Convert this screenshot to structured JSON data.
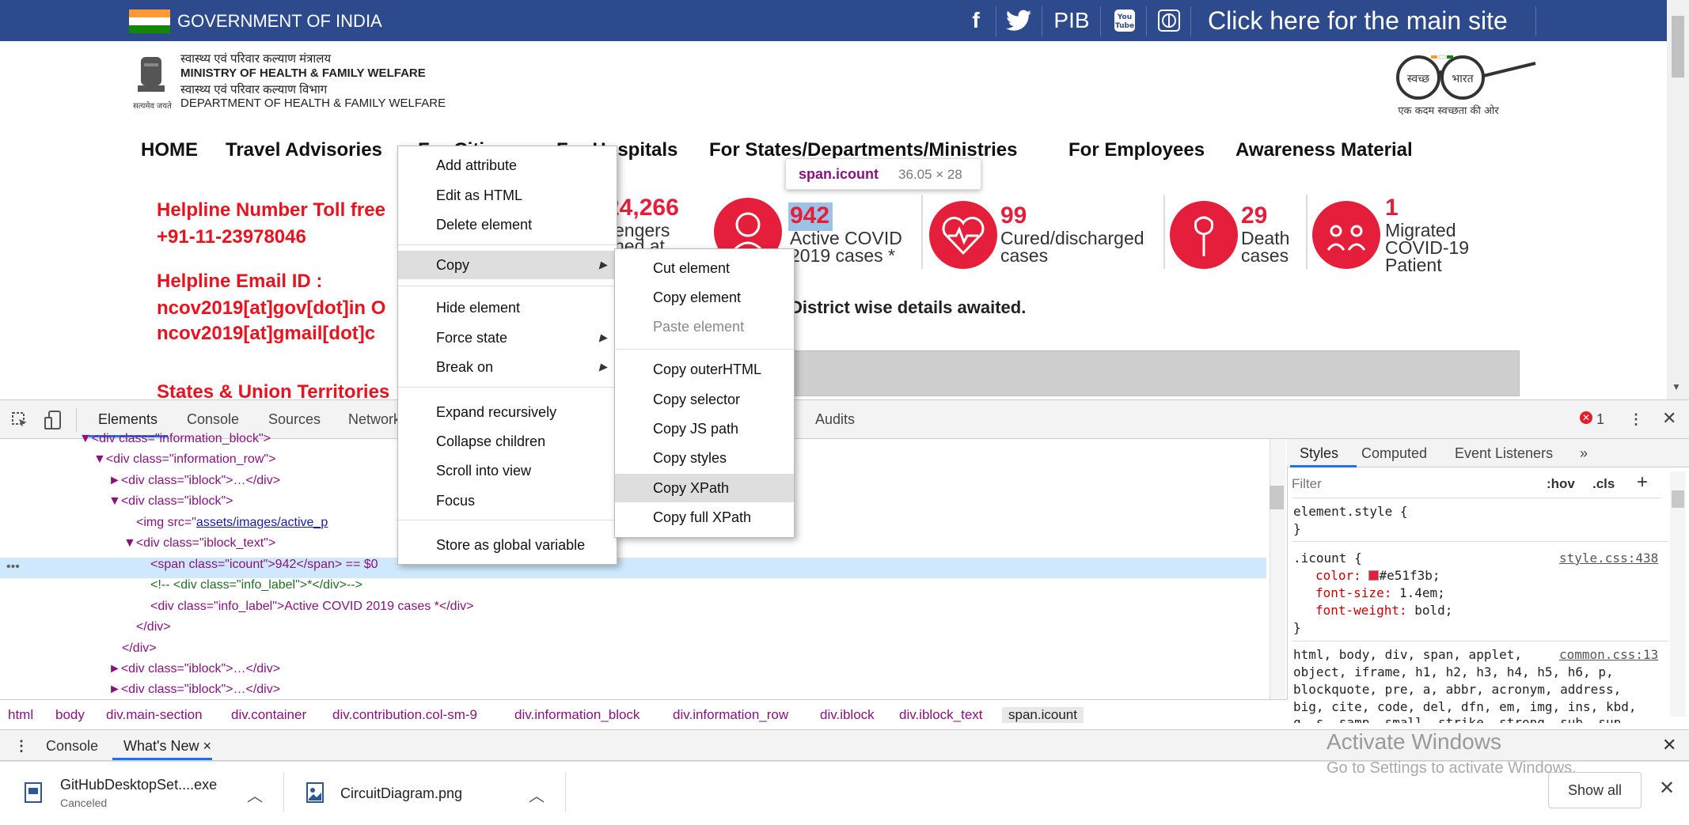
{
  "gov_bar": {
    "title": "GOVERNMENT OF INDIA",
    "links": [
      "f",
      "PIB"
    ],
    "main_site": "Click here for the main site"
  },
  "ministry": {
    "line1": "स्वास्थ्य एवं परिवार कल्याण मंत्रालय",
    "line2": "MINISTRY OF HEALTH & FAMILY WELFARE",
    "line3": "स्वास्थ्य एवं परिवार कल्याण विभाग",
    "line4": "DEPARTMENT OF HEALTH & FAMILY WELFARE",
    "emblem_caption": "सत्यमेव जयते"
  },
  "swachh": {
    "left": "स्वच्छ",
    "right": "भारत",
    "tagline": "एक कदम स्वच्छता की ओर"
  },
  "nav": {
    "items": [
      "HOME",
      "Travel Advisories",
      "For Citizens",
      "For Hospitals",
      "For States/Departments/Ministries",
      "For Employees",
      "Awareness Material"
    ]
  },
  "helpline": {
    "number_title": "Helpline Number Toll free",
    "number": "+91-11-23978046",
    "email_title": "Helpline Email ID :",
    "email1": "ncov2019[at]gov[dot]in O",
    "email2": "ncov2019[at]gmail[dot]c",
    "states": "States & Union Territories"
  },
  "stats": {
    "passengers_num": "24,266",
    "passengers_label1": "engers",
    "passengers_label2": "ned at",
    "active_num": "942",
    "active_label": "Active COVID\n2019 cases *",
    "cured_num": "99",
    "cured_label": "Cured/discharged\ncases",
    "death_num": "29",
    "death_label": "Death\ncases",
    "migrated_num": "1",
    "migrated_label": "Migrated\nCOVID-19\nPatient",
    "district_note": "District wise details awaited."
  },
  "tooltip": {
    "selector": "span.icount",
    "size": "36.05 × 28"
  },
  "devtools": {
    "tabs": [
      "Elements",
      "Console",
      "Sources",
      "Network",
      "Audits"
    ],
    "error_count": "1",
    "code": {
      "l1": "▼<div class=\"information_block\">",
      "l2": "▼<div class=\"information_row\">",
      "l3": "►<div class=\"iblock\">…</div>",
      "l4": "▼<div class=\"iblock\">",
      "l5a": "<img src=\"",
      "l5b": "assets/images/active_p",
      "l6": "▼<div class=\"iblock_text\">",
      "l7": "<span class=\"icount\">942</span> == $0",
      "l8": "<!-- <div class=\"info_label\">*</div>-->",
      "l9": "<div class=\"info_label\">Active COVID 2019 cases *</div>",
      "l10": "</div>",
      "l11": "</div>",
      "l12": "►<div class=\"iblock\">…</div>",
      "l13": "►<div class=\"iblock\">…</div>",
      "dots": "•••"
    },
    "styles_tabs": [
      "Styles",
      "Computed",
      "Event Listeners",
      "»"
    ],
    "filter_placeholder": "Filter",
    "hov": ":hov",
    "cls": ".cls",
    "style_rules": {
      "element_style": "element.style {",
      "close": "}",
      "icount": ".icount {",
      "icount_src": "style.css:438",
      "color_prop": "color:",
      "color_val": "#e51f3b;",
      "fs_prop": "font-size:",
      "fs_val": "1.4em;",
      "fw_prop": "font-weight:",
      "fw_val": "bold;",
      "html_sel": "html, body, div, span, applet,",
      "html_src": "common.css:13",
      "l2": "object, iframe, h1, h2, h3, h4, h5, h6, p,",
      "l3": "blockquote, pre, a, abbr, acronym, address,",
      "l4": "big, cite, code, del, dfn, em, img, ins, kbd,",
      "l5": "q, s, samp, small, strike, strong, sub, sup,"
    },
    "breadcrumbs": [
      "html",
      "body",
      "div.main-section",
      "div.container",
      "div.contribution.col-sm-9",
      "div.information_block",
      "div.information_row",
      "div.iblock",
      "div.iblock_text",
      "span.icount"
    ],
    "drawer": {
      "console": "Console",
      "whats_new": "What's New ×"
    }
  },
  "context_menu": {
    "items": [
      "Add attribute",
      "Edit as HTML",
      "Delete element",
      "Copy",
      "Hide element",
      "Force state",
      "Break on",
      "Expand recursively",
      "Collapse children",
      "Scroll into view",
      "Focus",
      "Store as global variable"
    ]
  },
  "copy_submenu": {
    "items": [
      "Cut element",
      "Copy element",
      "Paste element",
      "Copy outerHTML",
      "Copy selector",
      "Copy JS path",
      "Copy styles",
      "Copy XPath",
      "Copy full XPath"
    ],
    "highlighted": "Copy XPath"
  },
  "downloads": {
    "file1": "GitHubDesktopSet....exe",
    "file1_status": "Canceled",
    "file2": "CircuitDiagram.png",
    "show_all": "Show all"
  },
  "watermark": {
    "line1": "Activate Windows",
    "line2": "Go to Settings to activate Windows."
  },
  "colors": {
    "gov_blue": "#2c4a8c",
    "accent_red": "#e51f3b",
    "selection": "#cfe8fc"
  }
}
